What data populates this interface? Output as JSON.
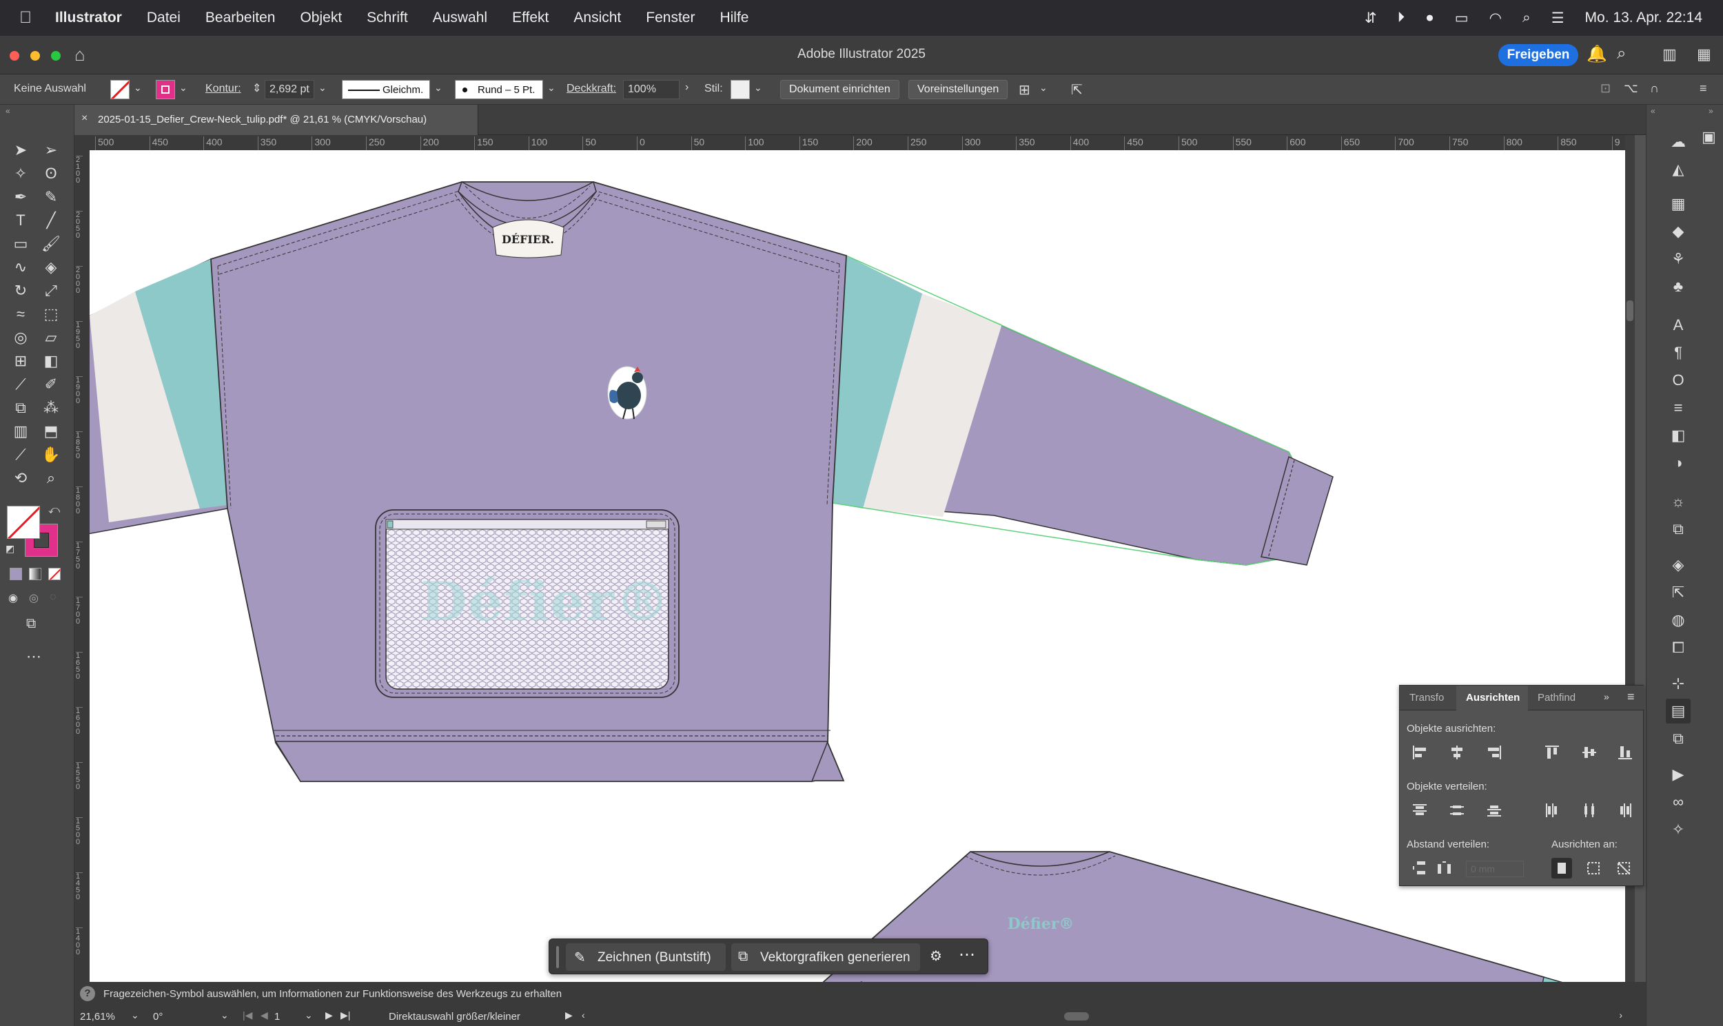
{
  "menubar": {
    "app": "Illustrator",
    "items": [
      "Datei",
      "Bearbeiten",
      "Objekt",
      "Schrift",
      "Auswahl",
      "Effekt",
      "Ansicht",
      "Fenster",
      "Hilfe"
    ],
    "clock": "Mo. 13. Apr.  22:14"
  },
  "titlebar": {
    "title": "Adobe Illustrator 2025",
    "share_label": "Freigeben"
  },
  "controlbar": {
    "selection": "Keine Auswahl",
    "stroke_label": "Kontur:",
    "stroke_value": "2,692 pt",
    "profile": "Gleichm.",
    "brush": "Rund – 5 Pt.",
    "opacity_label": "Deckkraft:",
    "opacity_value": "100%",
    "style_label": "Stil:",
    "doc_setup": "Dokument einrichten",
    "prefs": "Voreinstellungen"
  },
  "document": {
    "tab_title": "2025-01-15_Defier_Crew-Neck_tulip.pdf* @ 21,61 % (CMYK/Vorschau)"
  },
  "ruler": {
    "top_ticks": [
      "500",
      "450",
      "400",
      "350",
      "300",
      "250",
      "200",
      "150",
      "100",
      "50",
      "0",
      "50",
      "100",
      "150",
      "200",
      "250",
      "300",
      "350",
      "400",
      "450",
      "500",
      "550",
      "600",
      "650",
      "700",
      "750",
      "800",
      "850",
      "9"
    ],
    "left_ticks": [
      "2100",
      "2050",
      "2000",
      "1950",
      "1900",
      "1850",
      "1800",
      "1750",
      "1700",
      "1650",
      "1600",
      "1550",
      "1500",
      "1450",
      "1400"
    ]
  },
  "artwork": {
    "neck_label": "DÉFIER.",
    "pocket_text": "Défier®",
    "back_text": "Défier®",
    "colors": {
      "body": "#a598be",
      "cuff": "#8ec9c9",
      "stripe": "#ece9e6"
    }
  },
  "align_panel": {
    "tabs": [
      "Transfo",
      "Ausrichten",
      "Pathfind"
    ],
    "align_objects": "Objekte ausrichten:",
    "distribute_objects": "Objekte verteilen:",
    "distribute_spacing": "Abstand verteilen:",
    "align_to": "Ausrichten an:",
    "spacing_value": "0 mm"
  },
  "context_bar": {
    "draw_label": "Zeichnen (Buntstift)",
    "vector_label": "Vektorgrafiken generieren"
  },
  "status": {
    "hint": "Fragezeichen-Symbol auswählen, um Informationen zur Funktionsweise des Werkzeugs zu erhalten",
    "zoom": "21,61%",
    "rotation": "0°",
    "artboard": "1",
    "tool": "Direktauswahl größer/kleiner"
  }
}
